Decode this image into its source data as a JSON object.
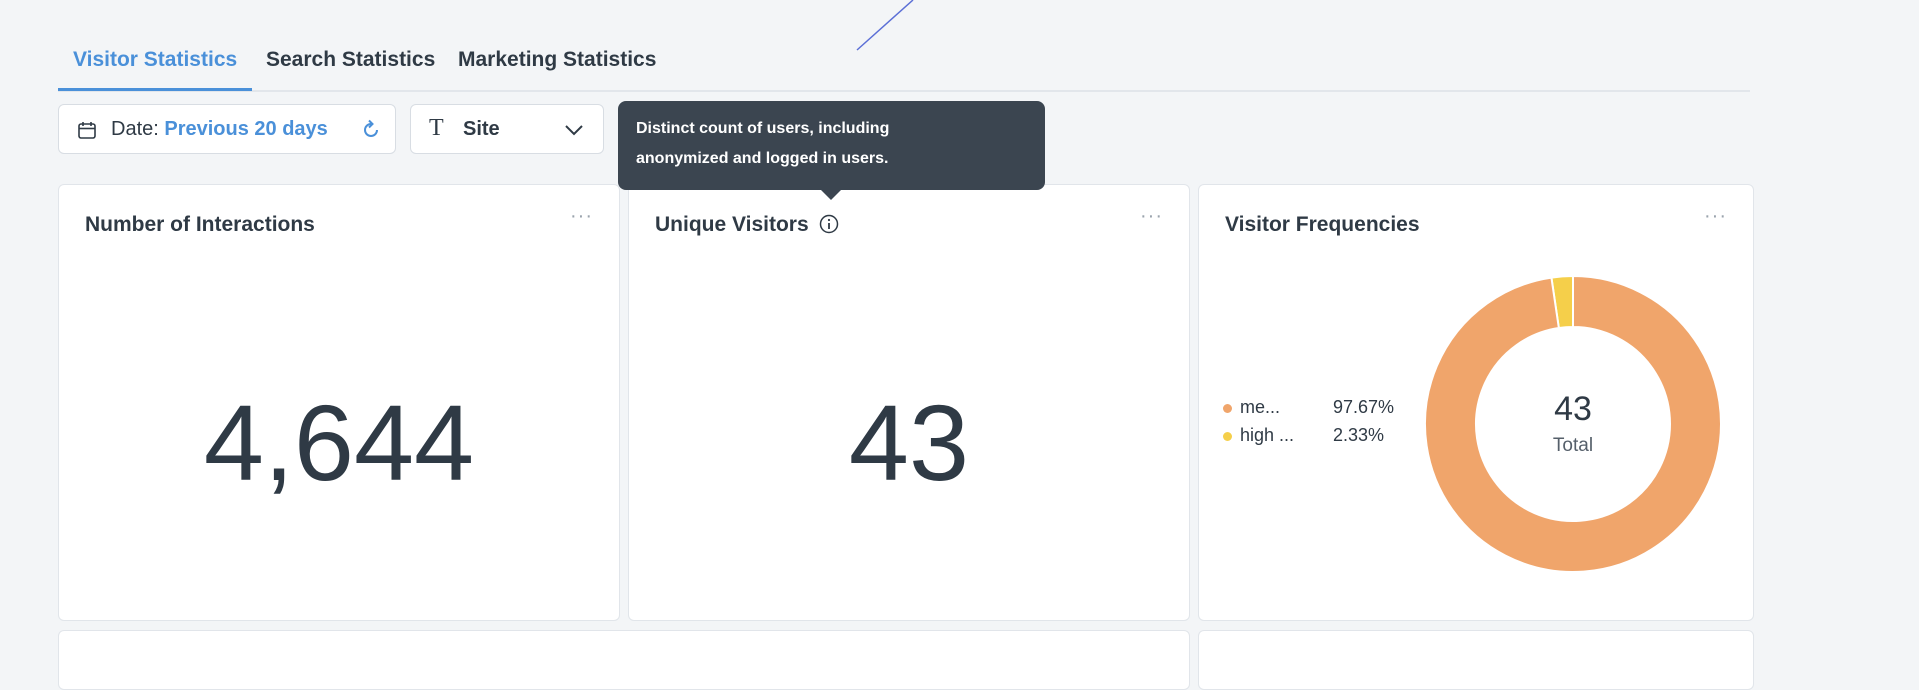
{
  "tabs": [
    {
      "label": "Visitor Statistics",
      "active": true
    },
    {
      "label": "Search Statistics",
      "active": false
    },
    {
      "label": "Marketing Statistics",
      "active": false
    }
  ],
  "filters": {
    "date_prefix": "Date: ",
    "date_value": "Previous 20 days",
    "site_label": "Site",
    "site_icon_text": "T"
  },
  "tooltip": {
    "line1": "Distinct count of users, including",
    "line2": "anonymized and logged in users."
  },
  "cards": {
    "interactions": {
      "title": "Number of Interactions",
      "value": "4,644",
      "more": "···"
    },
    "unique_visitors": {
      "title": "Unique Visitors",
      "value": "43",
      "more": "···"
    },
    "visitor_frequencies": {
      "title": "Visitor Frequencies",
      "more": "···",
      "center_value": "43",
      "center_label": "Total"
    }
  },
  "chart_data": {
    "type": "pie",
    "categories": [
      "me...",
      "high ..."
    ],
    "values": [
      97.67,
      2.33
    ],
    "value_labels": [
      "97.67%",
      "2.33%"
    ],
    "colors": [
      "#f0a56b",
      "#f5cf4a"
    ],
    "total": 43
  },
  "colors": {
    "accent": "#4a90d9",
    "tooltip_bg": "#3b4550"
  }
}
